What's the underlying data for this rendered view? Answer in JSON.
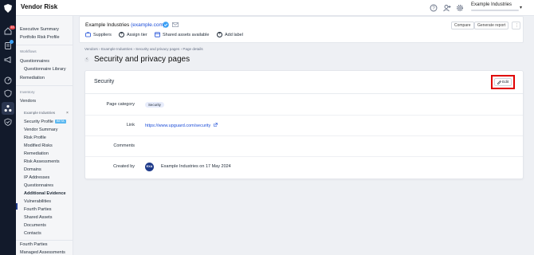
{
  "app": {
    "title": "Vendor Risk"
  },
  "account": {
    "name": "Example Industries"
  },
  "rail": {
    "badge_count": "14"
  },
  "sidebar": {
    "top_items": [
      "Executive Summary",
      "Portfolio Risk Profile"
    ],
    "workflows_section": "Workflows",
    "workflows_items": [
      "Questionnaires"
    ],
    "questionnaire_library": "Questionnaire Library",
    "remediation": "Remediation",
    "inventory_section": "Inventory",
    "vendors": "Vendors",
    "vendor_group": "Example Industries",
    "vendor_group_close": "×",
    "security_profile": "Security Profile",
    "beta_badge": "BETA",
    "vendor_items": [
      "Vendor Summary",
      "Risk Profile",
      "Modified Risks",
      "Remediation",
      "Risk Assessments",
      "Domains",
      "IP Addresses",
      "Questionnaires",
      "Additional Evidence",
      "Vulnerabilities",
      "Fourth Parties",
      "Shared Assets",
      "Documents",
      "Contacts"
    ],
    "bottom_items": [
      "Fourth Parties",
      "Managed Assessments"
    ]
  },
  "header": {
    "company_name": "Example Industries",
    "company_domain": "(example.com)",
    "suppliers": "Suppliers",
    "assign_tier": "Assign tier",
    "shared_assets": "Shared assets available",
    "add_label": "Add label",
    "compare": "Compare",
    "generate_report": "Generate report",
    "more": "⋮"
  },
  "breadcrumb": [
    "Vendors",
    "Example Industries",
    "Security and privacy pages",
    "Page details"
  ],
  "breadcrumb_sep": "›",
  "page": {
    "title": "Security and privacy pages",
    "collapse": "‹"
  },
  "card": {
    "title": "Security",
    "edit_label": "Edit",
    "rows": {
      "category_label": "Page category",
      "category_value": "Security",
      "link_label": "Link",
      "link_value": "https://www.upguard.com/security",
      "comments_label": "Comments",
      "created_label": "Created by",
      "avatar_initials": "EXA",
      "created_value": "Example Industries on 17 May 2024"
    }
  },
  "colors": {
    "rail_bg": "#121a2b",
    "link": "#1d4ed8",
    "highlight": "#e00000",
    "badge_red": "#e5484d"
  }
}
